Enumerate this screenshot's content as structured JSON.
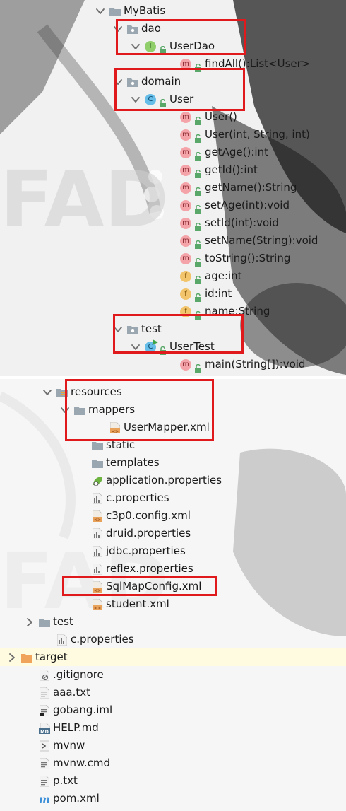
{
  "tree": {
    "top": [
      {
        "label": "MyBatis",
        "icon": "folder-icon",
        "arrow": "down"
      },
      {
        "label": "dao",
        "icon": "package-icon",
        "arrow": "down"
      },
      {
        "label": "UserDao",
        "icon": "interface-icon",
        "arrow": "down",
        "badge": "I"
      },
      {
        "label": "findAll():List<User>",
        "icon": "method-icon",
        "badge": "m"
      },
      {
        "label": "domain",
        "icon": "package-icon",
        "arrow": "down"
      },
      {
        "label": "User",
        "icon": "class-icon",
        "arrow": "down",
        "badge": "C"
      },
      {
        "label": "User()",
        "icon": "method-icon",
        "badge": "m"
      },
      {
        "label": "User(int, String, int)",
        "icon": "method-icon",
        "badge": "m"
      },
      {
        "label": "getAge():int",
        "icon": "method-icon",
        "badge": "m"
      },
      {
        "label": "getId():int",
        "icon": "method-icon",
        "badge": "m"
      },
      {
        "label": "getName():String",
        "icon": "method-icon",
        "badge": "m"
      },
      {
        "label": "setAge(int):void",
        "icon": "method-icon",
        "badge": "m"
      },
      {
        "label": "setId(int):void",
        "icon": "method-icon",
        "badge": "m"
      },
      {
        "label": "setName(String):void",
        "icon": "method-icon",
        "badge": "m"
      },
      {
        "label": "toString():String",
        "icon": "method-icon",
        "badge": "m"
      },
      {
        "label": "age:int",
        "icon": "field-icon",
        "badge": "f"
      },
      {
        "label": "id:int",
        "icon": "field-icon",
        "badge": "f"
      },
      {
        "label": "name:String",
        "icon": "field-icon",
        "badge": "f"
      },
      {
        "label": "test",
        "icon": "package-icon",
        "arrow": "down"
      },
      {
        "label": "UserTest",
        "icon": "test-class-icon",
        "arrow": "down",
        "badge": "C"
      },
      {
        "label": "main(String[]):void",
        "icon": "method-icon",
        "badge": "m"
      }
    ],
    "bottom": [
      {
        "label": "resources",
        "icon": "resources-folder-icon",
        "arrow": "down"
      },
      {
        "label": "mappers",
        "icon": "folder-icon",
        "arrow": "down"
      },
      {
        "label": "UserMapper.xml",
        "icon": "xml-file-icon"
      },
      {
        "label": "static",
        "icon": "folder-icon"
      },
      {
        "label": "templates",
        "icon": "folder-icon"
      },
      {
        "label": "application.properties",
        "icon": "spring-properties-icon"
      },
      {
        "label": "c.properties",
        "icon": "properties-file-icon"
      },
      {
        "label": "c3p0.config.xml",
        "icon": "xml-file-icon"
      },
      {
        "label": "druid.properties",
        "icon": "properties-file-icon"
      },
      {
        "label": "jdbc.properties",
        "icon": "properties-file-icon"
      },
      {
        "label": "reflex.properties",
        "icon": "properties-file-icon"
      },
      {
        "label": "SqlMapConfig.xml",
        "icon": "xml-file-icon"
      },
      {
        "label": "student.xml",
        "icon": "xml-file-icon"
      },
      {
        "label": "test",
        "icon": "folder-icon",
        "arrow": "right"
      },
      {
        "label": "c.properties",
        "icon": "properties-file-icon"
      },
      {
        "label": "target",
        "icon": "orange-folder-icon",
        "arrow": "right"
      },
      {
        "label": ".gitignore",
        "icon": "gitignore-file-icon"
      },
      {
        "label": "aaa.txt",
        "icon": "text-file-icon"
      },
      {
        "label": "gobang.iml",
        "icon": "iml-file-icon"
      },
      {
        "label": "HELP.md",
        "icon": "markdown-file-icon"
      },
      {
        "label": "mvnw",
        "icon": "shell-file-icon"
      },
      {
        "label": "mvnw.cmd",
        "icon": "text-file-icon"
      },
      {
        "label": "p.txt",
        "icon": "text-file-icon"
      },
      {
        "label": "pom.xml",
        "icon": "maven-icon"
      }
    ]
  },
  "colors": {
    "highlight_border": "#e0191d",
    "method_badge": "#f4a3a8",
    "field_badge": "#f2c46b",
    "class_badge": "#66bde8",
    "interface_badge": "#8fce6a",
    "folder": "#9aa7b0",
    "orange_folder": "#f0a35b",
    "lock": "#59a869"
  }
}
